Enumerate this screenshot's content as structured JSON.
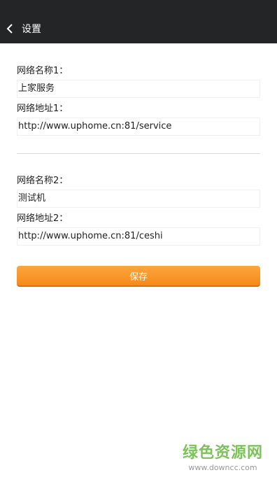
{
  "header": {
    "title": "设置",
    "back_icon": "chevron-left-icon"
  },
  "network1": {
    "name_label": "网络名称1：",
    "name_value": "上家服务",
    "address_label": "网络地址1：",
    "address_value": "http://www.uphome.cn:81/service"
  },
  "network2": {
    "name_label": "网络名称2：",
    "name_value": "测试机",
    "address_label": "网络地址2：",
    "address_value": "http://www.uphome.cn:81/ceshi"
  },
  "save_label": "保存",
  "watermark": {
    "title": "绿色资源网",
    "url": "www.downcc.com"
  },
  "colors": {
    "bar": "#232526",
    "accent": "#f68a1a",
    "watermark": "#7cc35a"
  }
}
